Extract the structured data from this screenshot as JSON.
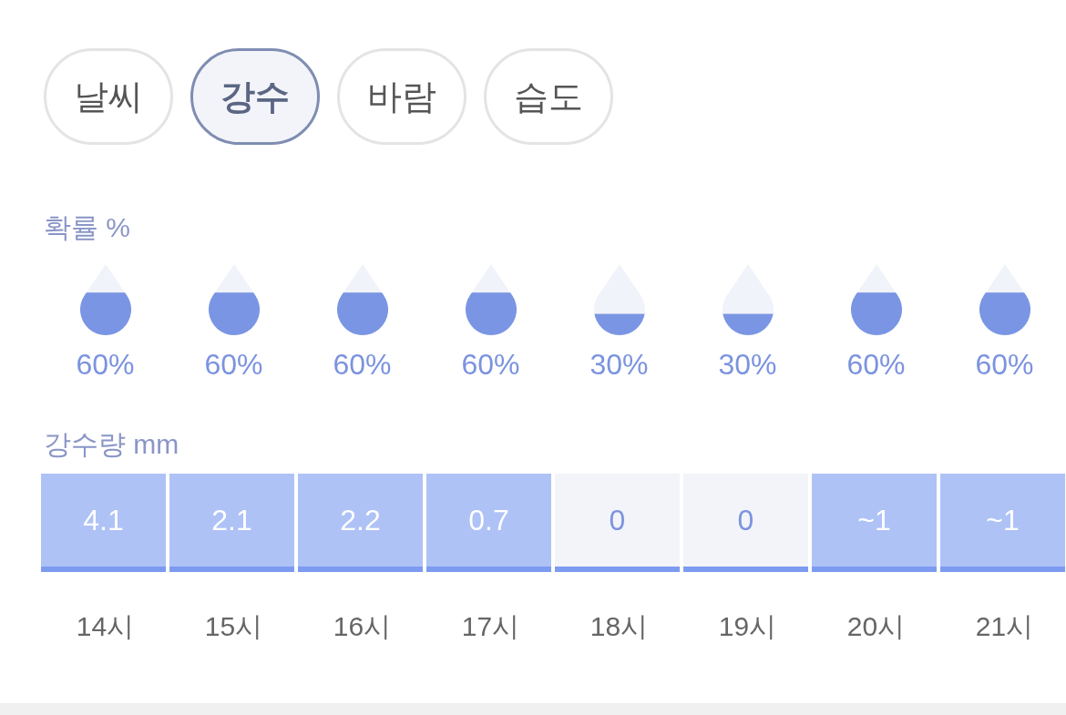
{
  "tabs": [
    {
      "label": "날씨",
      "selected": false
    },
    {
      "label": "강수",
      "selected": true
    },
    {
      "label": "바람",
      "selected": false
    },
    {
      "label": "습도",
      "selected": false
    }
  ],
  "probability": {
    "label": "확률 %",
    "items": [
      {
        "level": 0.6,
        "reading": "60%"
      },
      {
        "level": 0.6,
        "reading": "60%"
      },
      {
        "level": 0.6,
        "reading": "60%"
      },
      {
        "level": 0.6,
        "reading": "60%"
      },
      {
        "level": 0.3,
        "reading": "30%"
      },
      {
        "level": 0.3,
        "reading": "30%"
      },
      {
        "level": 0.6,
        "reading": "60%"
      },
      {
        "level": 0.6,
        "reading": "60%"
      }
    ]
  },
  "amount": {
    "label": "강수량 mm",
    "cells": [
      {
        "value": "4.1",
        "kind": "wet"
      },
      {
        "value": "2.1",
        "kind": "wet"
      },
      {
        "value": "2.2",
        "kind": "wet"
      },
      {
        "value": "0.7",
        "kind": "wet"
      },
      {
        "value": "0",
        "kind": "dry"
      },
      {
        "value": "0",
        "kind": "dry"
      },
      {
        "value": "~1",
        "kind": "wet"
      },
      {
        "value": "~1",
        "kind": "wet"
      }
    ]
  },
  "hours": [
    "14시",
    "15시",
    "16시",
    "17시",
    "18시",
    "19시",
    "20시",
    "21시"
  ]
}
